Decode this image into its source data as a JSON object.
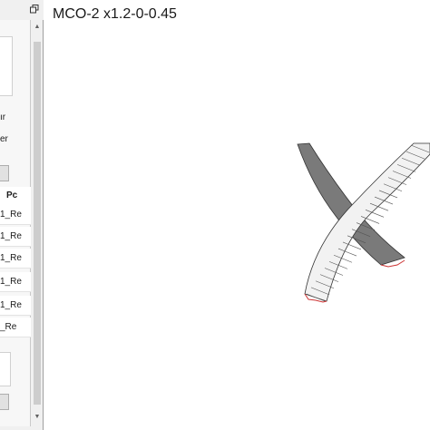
{
  "viewport": {
    "title": "MCO-2 x1.2-0-0.45"
  },
  "left_panel": {
    "option_labels": [
      "ır",
      "er"
    ],
    "table": {
      "column_header": "Pc",
      "rows": [
        "1_Re",
        "1_Re",
        "1_Re",
        "1_Re",
        "1_Re",
        "_Re"
      ]
    }
  },
  "colors": {
    "dark_blade": "#7a7a7a",
    "light_blade": "#f2f2f2",
    "hatch": "#555555",
    "root_marks": "#cc3333"
  },
  "icons": [
    "restore-icon",
    "scroll-up-icon",
    "scroll-down-icon"
  ]
}
